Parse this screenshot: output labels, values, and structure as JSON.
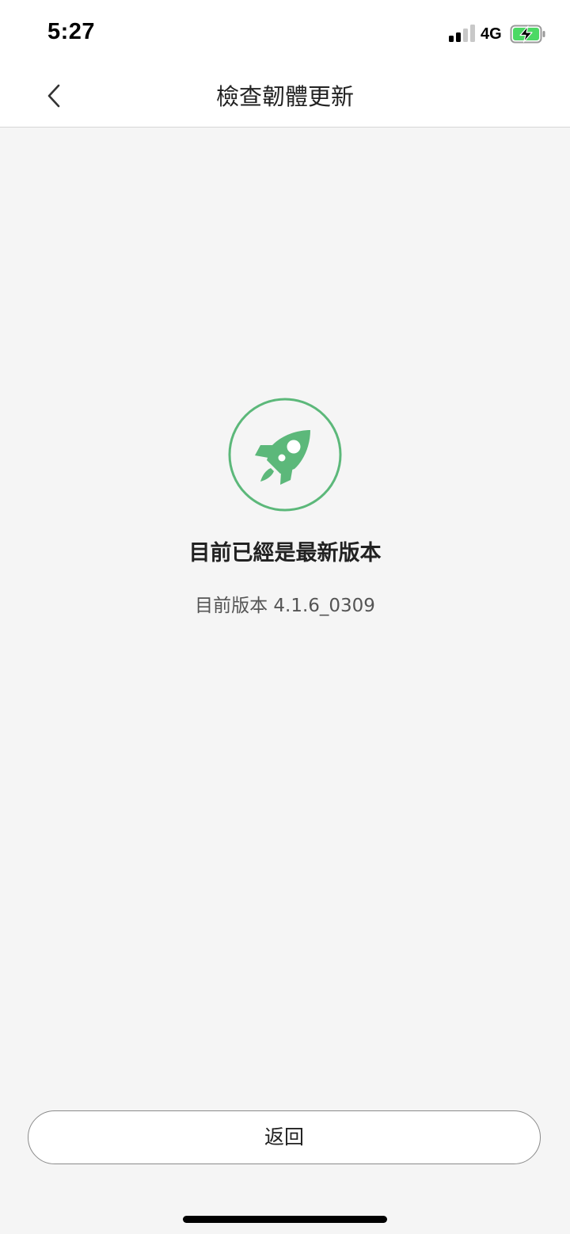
{
  "status_bar": {
    "time": "5:27",
    "network": "4G",
    "signal_bars_active": 2,
    "signal_bars_total": 4,
    "battery_charging": true,
    "battery_color": "#4cd964"
  },
  "nav": {
    "back_icon": "chevron-left-icon",
    "title": "檢查韌體更新"
  },
  "main": {
    "icon": "rocket-icon",
    "accent_color": "#5cb87a",
    "status_title": "目前已經是最新版本",
    "version_text": "目前版本 4.1.6_0309"
  },
  "footer": {
    "return_label": "返回"
  }
}
